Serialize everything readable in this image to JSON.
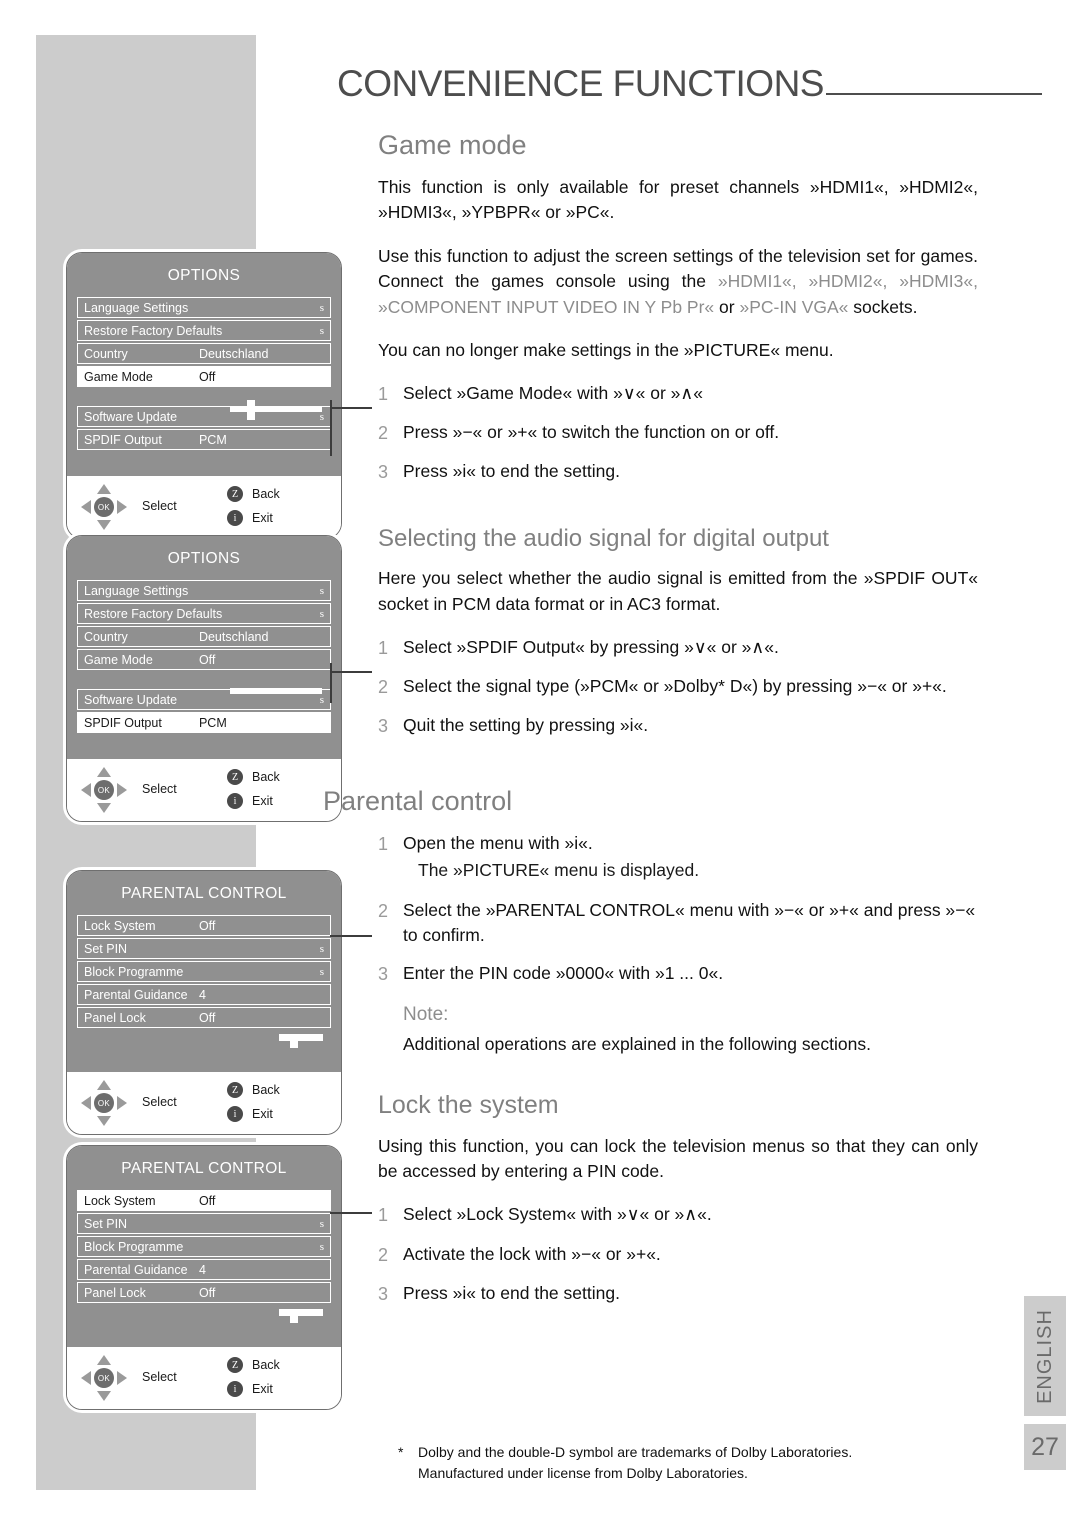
{
  "header": {
    "title": "CONVENIENCE FUNCTIONS"
  },
  "sections": {
    "game_mode": {
      "heading": "Game mode",
      "para1": "This function is only available for preset channels »HDMI1«, »HDMI2«, »HDMI3«, »YPBPR« or »PC«.",
      "para2_a": "Use this function to adjust the screen settings of the television set for games. Connect the games console using the ",
      "para2_grey1": "»HDMI1«, »HDMI2«, »HDMI3«, »COMPONENT INPUT VIDEO IN Y Pb Pr«",
      "para2_b": " or ",
      "para2_grey2": "»PC-IN VGA«",
      "para2_c": " sockets.",
      "para3": "You can no longer make settings in the »PICTURE« menu.",
      "steps": [
        {
          "num": "1",
          "text": "Select »Game Mode« with »∨« or »∧«"
        },
        {
          "num": "2",
          "text": "Press »−« or »+« to switch the function on or off."
        },
        {
          "num": "3",
          "text": "Press »i« to end the setting."
        }
      ]
    },
    "spdif": {
      "heading": "Selecting the audio signal for digital output",
      "para1": "Here you select whether the audio signal is emitted from the »SPDIF OUT« socket in PCM data format or in AC3 format.",
      "steps": [
        {
          "num": "1",
          "text": "Select »SPDIF Output« by pressing »∨« or »∧«."
        },
        {
          "num": "2",
          "text": "Select the signal type (»PCM« or »Dolby* D«) by pressing »−« or »+«."
        },
        {
          "num": "3",
          "text": "Quit the setting by pressing »i«."
        }
      ]
    },
    "parental": {
      "heading": "Parental control",
      "steps": [
        {
          "num": "1",
          "text": "Open the menu with »i«.",
          "subline": "The »PICTURE« menu is displayed."
        },
        {
          "num": "2",
          "text": "Select the »PARENTAL CONTROL« menu with »−« or »+« and press »−« to confirm."
        },
        {
          "num": "3",
          "text": "Enter the PIN code »0000« with »1 ... 0«."
        }
      ],
      "note_label": "Note:",
      "note_body": "Additional operations are explained in the following sections."
    },
    "lock_system": {
      "heading": "Lock the system",
      "para1": "Using this function, you can lock the television menus so that they can only be accessed by entering a PIN code.",
      "steps": [
        {
          "num": "1",
          "text": "Select »Lock System« with »∨« or »∧«."
        },
        {
          "num": "2",
          "text": "Activate the lock with »−« or »+«."
        },
        {
          "num": "3",
          "text": "Press »i« to end the setting."
        }
      ]
    }
  },
  "osd_panels": [
    {
      "id": "options-game-mode",
      "title": "OPTIONS",
      "rows": [
        {
          "label": "Language Settings",
          "value": "",
          "mark": "s",
          "selected": false
        },
        {
          "label": "Restore Factory Defaults",
          "value": "",
          "mark": "s",
          "selected": false
        },
        {
          "label": "Country",
          "value": "Deutschland",
          "mark": "",
          "selected": false
        },
        {
          "label": "Game Mode",
          "value": "Off",
          "mark": "",
          "selected": true
        },
        {
          "label": "Software Update",
          "value": "",
          "mark": "s",
          "selected": false,
          "after_gap": true
        },
        {
          "label": "SPDIF Output",
          "value": "PCM",
          "mark": "",
          "selected": false
        }
      ],
      "footer": {
        "select": "Select",
        "back_badge": "Z",
        "back": "Back",
        "exit_badge": "i",
        "exit": "Exit"
      }
    },
    {
      "id": "options-spdif",
      "title": "OPTIONS",
      "rows": [
        {
          "label": "Language Settings",
          "value": "",
          "mark": "s",
          "selected": false
        },
        {
          "label": "Restore Factory Defaults",
          "value": "",
          "mark": "s",
          "selected": false
        },
        {
          "label": "Country",
          "value": "Deutschland",
          "mark": "",
          "selected": false
        },
        {
          "label": "Game Mode",
          "value": "Off",
          "mark": "",
          "selected": false
        },
        {
          "label": "Software Update",
          "value": "",
          "mark": "s",
          "selected": false,
          "after_gap": true
        },
        {
          "label": "SPDIF Output",
          "value": "PCM",
          "mark": "",
          "selected": true
        }
      ],
      "footer": {
        "select": "Select",
        "back_badge": "Z",
        "back": "Back",
        "exit_badge": "i",
        "exit": "Exit"
      }
    },
    {
      "id": "parental-control-menu",
      "title": "PARENTAL CONTROL",
      "rows": [
        {
          "label": "Lock System",
          "value": "Off",
          "mark": "",
          "selected": false
        },
        {
          "label": "Set PIN",
          "value": "",
          "mark": "s",
          "selected": false
        },
        {
          "label": "Block Programme",
          "value": "",
          "mark": "s",
          "selected": false
        },
        {
          "label": "Parental Guidance",
          "value": "4",
          "mark": "",
          "selected": false
        },
        {
          "label": "Panel Lock",
          "value": "Off",
          "mark": "",
          "selected": false
        }
      ],
      "footer": {
        "select": "Select",
        "back_badge": "Z",
        "back": "Back",
        "exit_badge": "i",
        "exit": "Exit"
      }
    },
    {
      "id": "parental-control-lock-system",
      "title": "PARENTAL CONTROL",
      "rows": [
        {
          "label": "Lock System",
          "value": "Off",
          "mark": "",
          "selected": true
        },
        {
          "label": "Set PIN",
          "value": "",
          "mark": "s",
          "selected": false
        },
        {
          "label": "Block Programme",
          "value": "",
          "mark": "s",
          "selected": false
        },
        {
          "label": "Parental Guidance",
          "value": "4",
          "mark": "",
          "selected": false
        },
        {
          "label": "Panel Lock",
          "value": "Off",
          "mark": "",
          "selected": false
        }
      ],
      "footer": {
        "select": "Select",
        "back_badge": "Z",
        "back": "Back",
        "exit_badge": "i",
        "exit": "Exit"
      }
    }
  ],
  "footnote": {
    "star": "*",
    "line1": "Dolby and the double-D symbol are trademarks of Dolby Laboratories.",
    "line2": "Manufactured under license from Dolby Laboratories."
  },
  "side": {
    "language": "ENGLISH",
    "page": "27"
  }
}
